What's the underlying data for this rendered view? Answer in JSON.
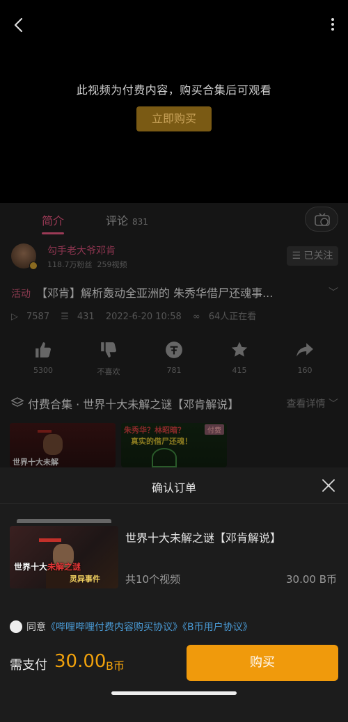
{
  "video": {
    "paywall_text": "此视频为付费内容，购买合集后可观看",
    "buy_now_label": "立即购买"
  },
  "tabs": {
    "intro": "简介",
    "comments": "评论",
    "comments_count": "831"
  },
  "uploader": {
    "name": "勾手老大爷邓肯",
    "followers": "118.7万粉丝",
    "videos": "259视频",
    "follow_label": "☰ 已关注"
  },
  "video_info": {
    "activity_tag": "活动",
    "title": "【邓肯】解析轰动全亚洲的 朱秀华借尸还魂事...",
    "plays": "7587",
    "danmaku": "431",
    "datetime": "2022-6-20 10:58",
    "watching": "64人正在看"
  },
  "actions": [
    {
      "icon": "thumbs-up-icon",
      "label": "5300"
    },
    {
      "icon": "thumbs-down-icon",
      "label": "不喜欢"
    },
    {
      "icon": "coin-icon",
      "label": "781"
    },
    {
      "icon": "star-icon",
      "label": "415"
    },
    {
      "icon": "share-icon",
      "label": "160"
    }
  ],
  "collection": {
    "title": "付费合集 · 世界十大未解之谜【邓肯解说】",
    "more_label": "查看详情"
  },
  "thumbs": {
    "thumb1_text": "世界十大未解",
    "thumb2_text": "朱秀华？林昭暗？",
    "thumb2_text2": "真实的借尸还魂！",
    "paid_badge": "付费"
  },
  "order": {
    "sheet_title": "确认订单",
    "name": "世界十大未解之谜【邓肯解说】",
    "count": "共10个视频",
    "price": "30.00 B币",
    "cover_text1": "世界十大",
    "cover_text1_red": "未解之谜",
    "cover_text2": "灵异事件",
    "agree_prefix": "同意",
    "agree_link1": "《哔哩哔哩付费内容购买协议》",
    "agree_link2": "《B币用户协议》",
    "pay_label": "需支付",
    "pay_amount": "30.00",
    "pay_unit": "B币",
    "pay_button": "购买"
  },
  "colors": {
    "accent_pink": "#9c3a56",
    "pay_orange": "#f09a0c",
    "link_blue": "#4a9bd6"
  }
}
